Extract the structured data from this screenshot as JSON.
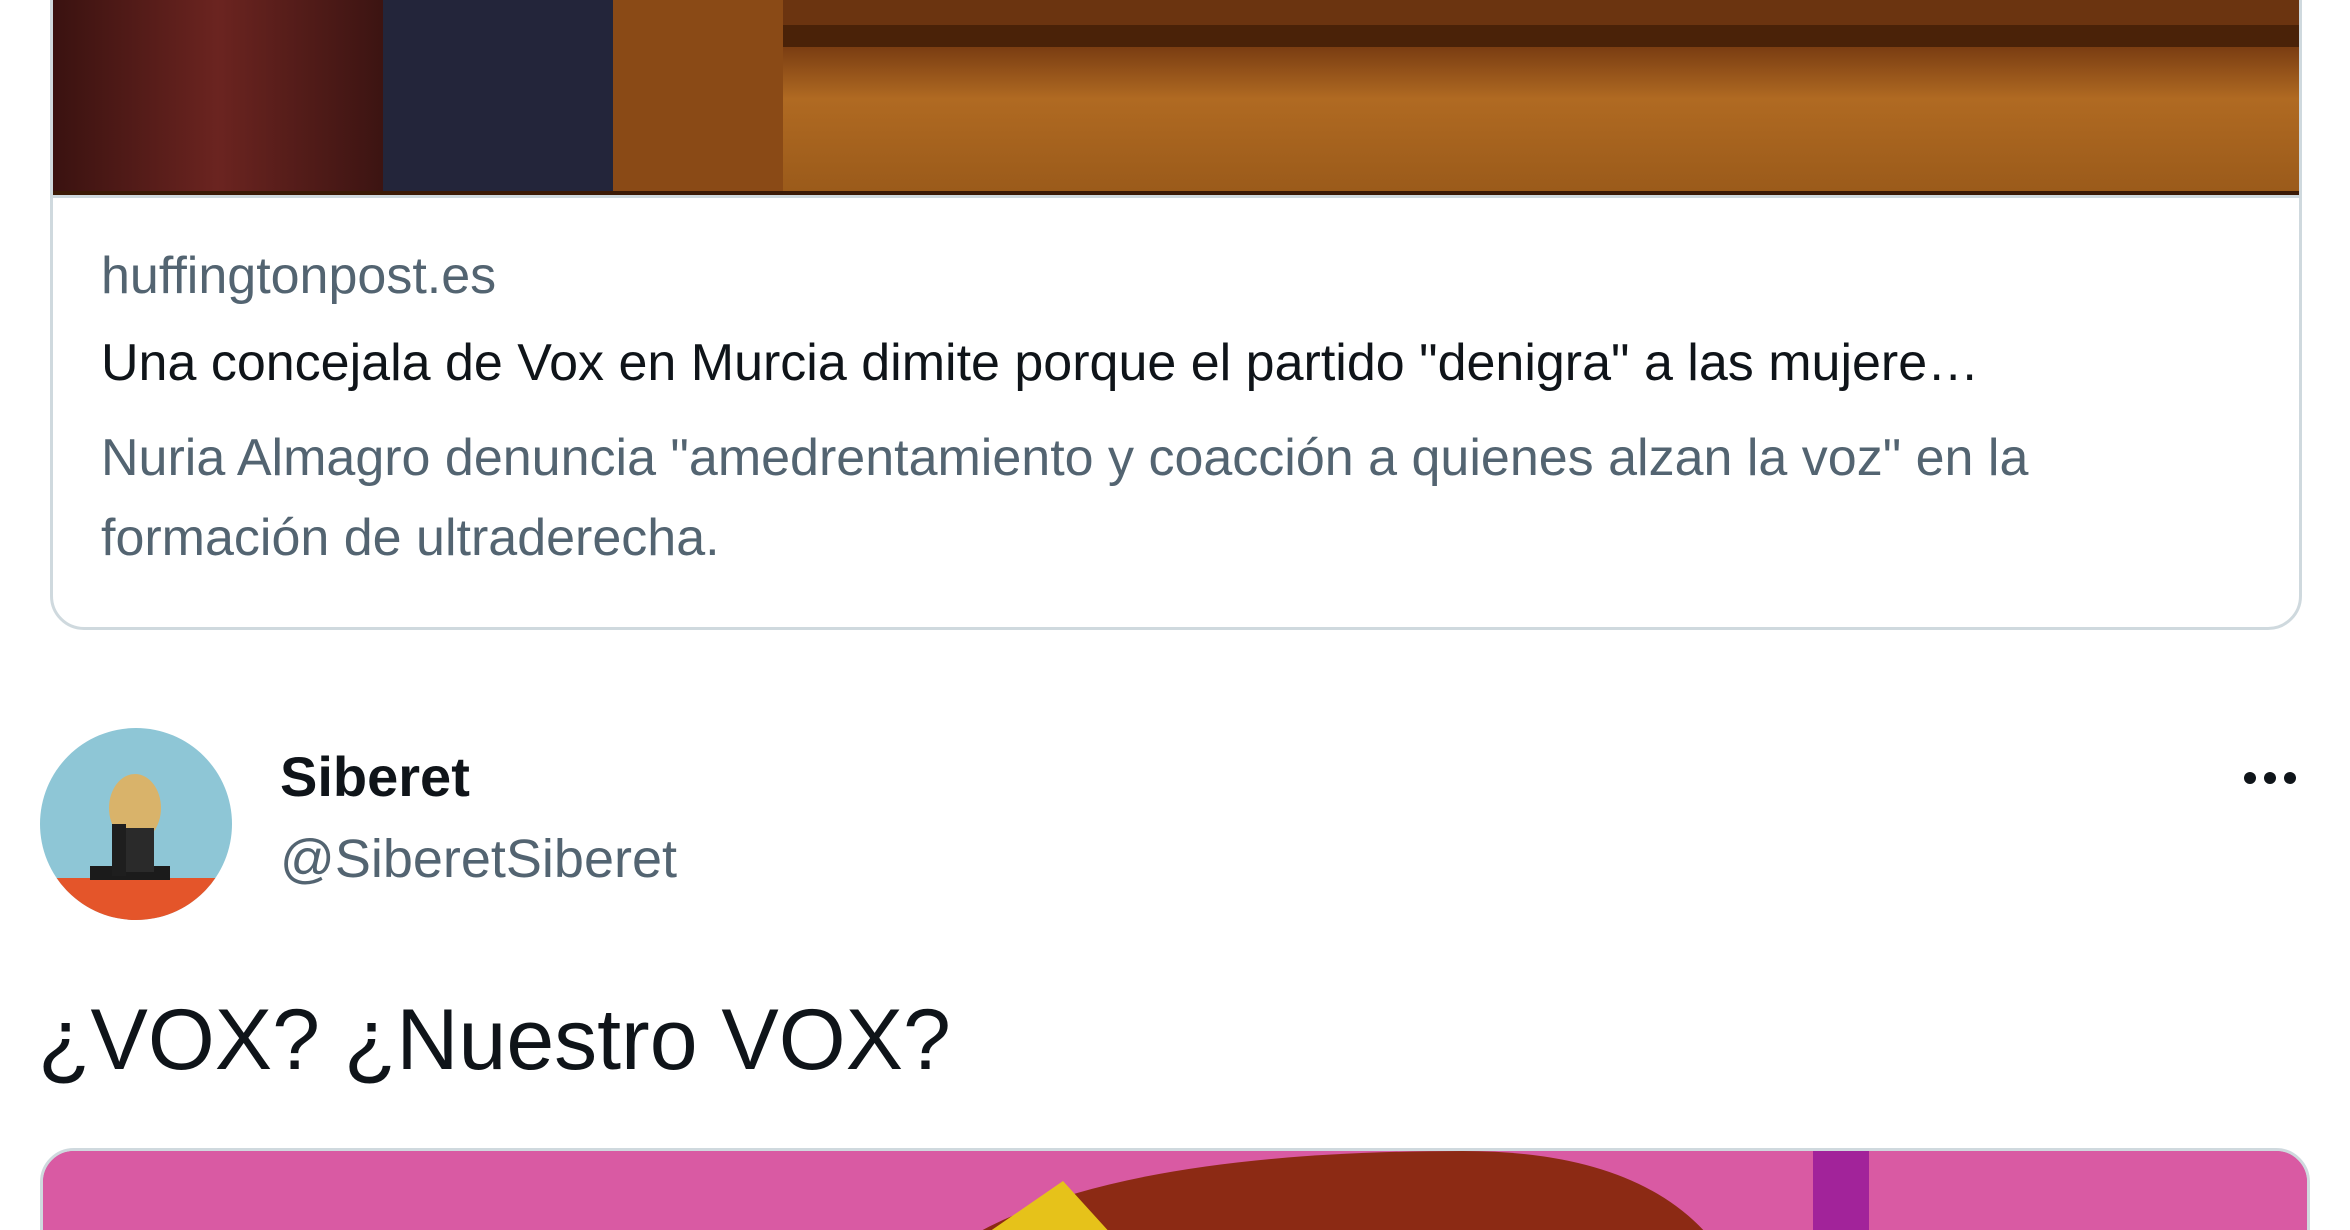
{
  "link_card": {
    "domain": "huffingtonpost.es",
    "title": "Una concejala de Vox en Murcia dimite porque el partido \"denigra\" a las mujere…",
    "description": "Nuria Almagro denuncia \"amedrentamiento y coacción a quienes alzan la voz\" en la formación de ultraderecha."
  },
  "tweet": {
    "author_name": "Siberet",
    "author_handle": "@SiberetSiberet",
    "text": "¿VOX? ¿Nuestro VOX?",
    "more_icon": "ellipsis-icon"
  },
  "colors": {
    "primary_text": "#0f1419",
    "secondary_text": "#536471",
    "border": "#cfd9de",
    "media_pink": "#d95aa3",
    "wood": "#a8651f"
  }
}
